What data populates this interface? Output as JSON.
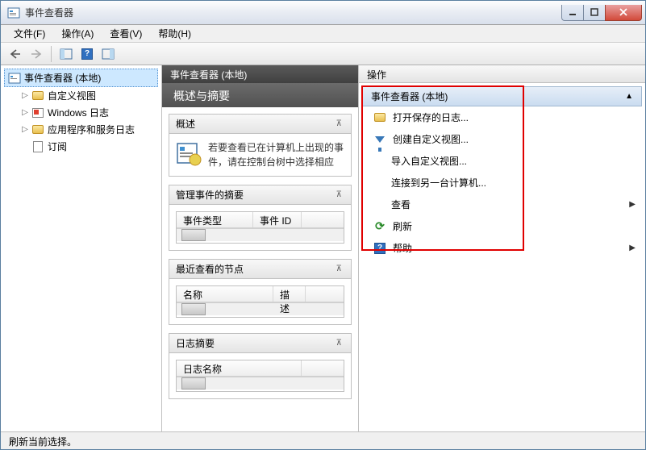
{
  "window": {
    "title": "事件查看器"
  },
  "menu": {
    "file": "文件(F)",
    "action": "操作(A)",
    "view": "查看(V)",
    "help": "帮助(H)"
  },
  "tree": {
    "root": "事件查看器 (本地)",
    "custom_views": "自定义视图",
    "windows_logs": "Windows 日志",
    "app_service_logs": "应用程序和服务日志",
    "subscriptions": "订阅"
  },
  "middle": {
    "header": "事件查看器 (本地)",
    "summary_title": "概述与摘要",
    "overview": {
      "title": "概述",
      "text": "若要查看已在计算机上出现的事件，请在控制台树中选择相应"
    },
    "admin_events": {
      "title": "管理事件的摘要",
      "col1": "事件类型",
      "col2": "事件 ID"
    },
    "recent_nodes": {
      "title": "最近查看的节点",
      "col1": "名称",
      "col2": "描述"
    },
    "log_summary": {
      "title": "日志摘要",
      "col1": "日志名称"
    }
  },
  "actions": {
    "header": "操作",
    "section_title": "事件查看器 (本地)",
    "open_saved": "打开保存的日志...",
    "create_custom": "创建自定义视图...",
    "import_custom": "导入自定义视图...",
    "connect": "连接到另一台计算机...",
    "view": "查看",
    "refresh": "刷新",
    "help": "帮助"
  },
  "status": "刷新当前选择。"
}
